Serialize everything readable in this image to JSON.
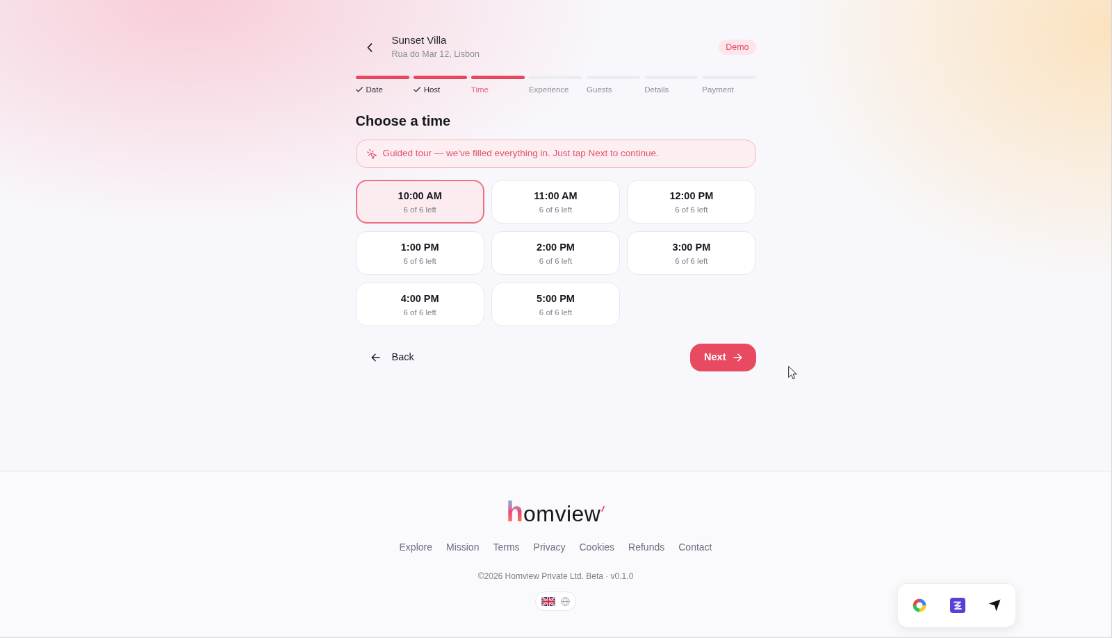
{
  "header": {
    "title": "Sunset Villa",
    "subtitle": "Rua do Mar 12, Lisbon",
    "badge": "Demo"
  },
  "steps": [
    {
      "label": "Date",
      "completed": true,
      "selected": false
    },
    {
      "label": "Host",
      "completed": true,
      "selected": false
    },
    {
      "label": "Time",
      "completed": false,
      "selected": true
    },
    {
      "label": "Experience",
      "completed": false,
      "selected": false
    },
    {
      "label": "Guests",
      "completed": false,
      "selected": false
    },
    {
      "label": "Details",
      "completed": false,
      "selected": false
    },
    {
      "label": "Payment",
      "completed": false,
      "selected": false
    }
  ],
  "heading": "Choose a time",
  "notice": "Guided tour — we've filled everything in. Just tap Next to continue.",
  "slots": [
    {
      "time": "10:00 AM",
      "availability": "6 of 6 left",
      "selected": true
    },
    {
      "time": "11:00 AM",
      "availability": "6 of 6 left",
      "selected": false
    },
    {
      "time": "12:00 PM",
      "availability": "6 of 6 left",
      "selected": false
    },
    {
      "time": "1:00 PM",
      "availability": "6 of 6 left",
      "selected": false
    },
    {
      "time": "2:00 PM",
      "availability": "6 of 6 left",
      "selected": false
    },
    {
      "time": "3:00 PM",
      "availability": "6 of 6 left",
      "selected": false
    },
    {
      "time": "4:00 PM",
      "availability": "6 of 6 left",
      "selected": false
    },
    {
      "time": "5:00 PM",
      "availability": "6 of 6 left",
      "selected": false
    }
  ],
  "actions": {
    "back": "Back",
    "next": "Next"
  },
  "footer": {
    "logo": {
      "mark": "h",
      "text": "omview"
    },
    "links": [
      "Explore",
      "Mission",
      "Terms",
      "Privacy",
      "Cookies",
      "Refunds",
      "Contact"
    ],
    "copyright": "©2026 Homview Private Ltd. Beta · v0.1.0"
  }
}
